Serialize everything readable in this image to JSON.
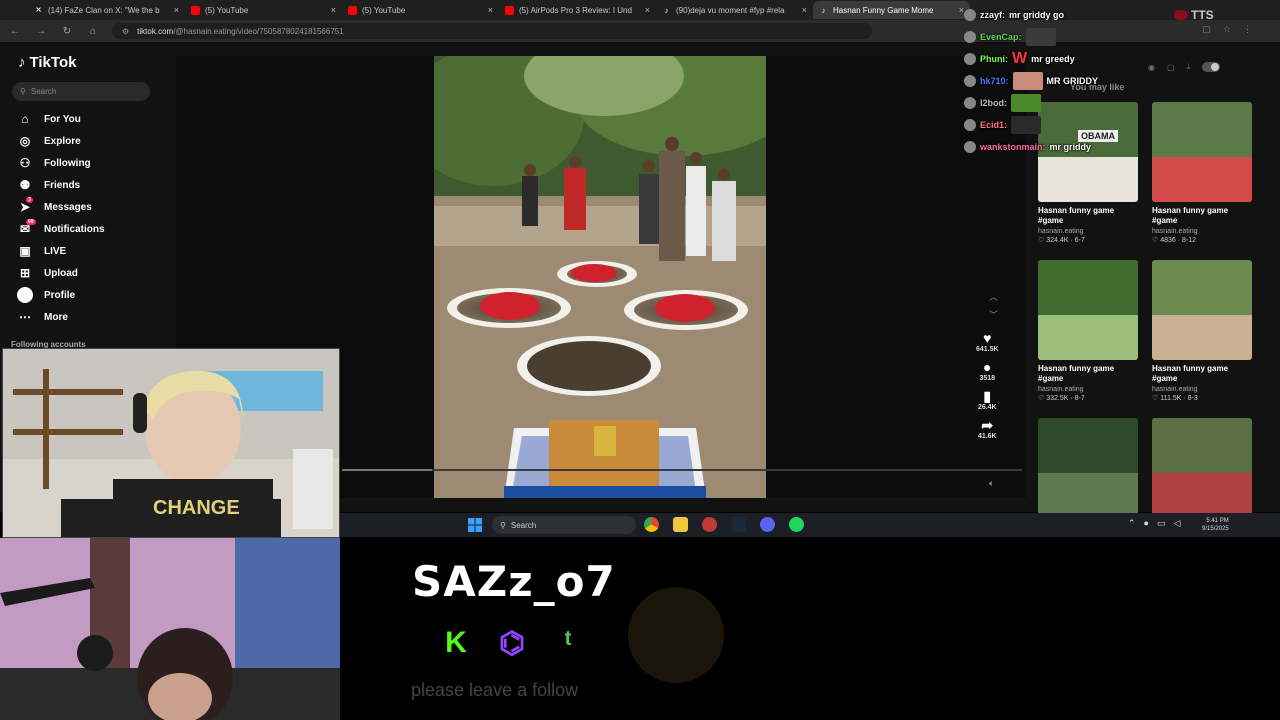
{
  "browser": {
    "tabs": [
      {
        "icon": "x",
        "label": "(14) FaZe Clan on X: \"We the b",
        "active": false
      },
      {
        "icon": "yt",
        "label": "(5) YouTube",
        "active": false
      },
      {
        "icon": "yt",
        "label": "(5) YouTube",
        "active": false
      },
      {
        "icon": "yt",
        "label": "(5) AirPods Pro 3 Review: I Und",
        "active": false
      },
      {
        "icon": "tt",
        "label": "(90)deja vu moment #fyp #rela",
        "active": false
      },
      {
        "icon": "tt",
        "label": "Hasnan Funny Game Mome",
        "active": true
      }
    ],
    "url_host": "tiktok.com",
    "url_path": "/@hasnain.eating/video/7505878024181566751"
  },
  "tiktok": {
    "logo": "TikTok",
    "search_placeholder": "Search",
    "nav": [
      {
        "icon": "home-icon",
        "glyph": "⌂",
        "label": "For You",
        "name": "nav-for-you"
      },
      {
        "icon": "compass-icon",
        "glyph": "◎",
        "label": "Explore",
        "name": "nav-explore"
      },
      {
        "icon": "following-icon",
        "glyph": "⚇",
        "label": "Following",
        "name": "nav-following"
      },
      {
        "icon": "friends-icon",
        "glyph": "⚉",
        "label": "Friends",
        "name": "nav-friends"
      },
      {
        "icon": "messages-icon",
        "glyph": "➤",
        "label": "Messages",
        "name": "nav-messages",
        "badge": "3"
      },
      {
        "icon": "bell-icon",
        "glyph": "✉",
        "label": "Notifications",
        "name": "nav-notifications",
        "badge": "99"
      },
      {
        "icon": "live-icon",
        "glyph": "▣",
        "label": "LIVE",
        "name": "nav-live"
      },
      {
        "icon": "upload-icon",
        "glyph": "⊞",
        "label": "Upload",
        "name": "nav-upload"
      },
      {
        "icon": "avatar",
        "glyph": "",
        "label": "Profile",
        "name": "nav-profile"
      },
      {
        "icon": "more-icon",
        "glyph": "⋯",
        "label": "More",
        "name": "nav-more"
      }
    ],
    "following_accounts": "Following accounts",
    "actions": {
      "likes": "641.5K",
      "comments": "3518",
      "saves": "26.4K",
      "shares": "41.6K"
    },
    "you_may_like": "You may like",
    "recommended": [
      {
        "title": "Hasnan funny game #game",
        "author": "hasnain.eating",
        "likes": "324.4K",
        "date": "6-7"
      },
      {
        "title": "Hasnan funny game #game",
        "author": "hasnain.eating",
        "likes": "4836",
        "date": "8-12"
      },
      {
        "title": "Hasnan funny game #game",
        "author": "hasnain.eating",
        "likes": "332.5K",
        "date": "8-7"
      },
      {
        "title": "Hasnan funny game #game",
        "author": "hasnain.eating",
        "likes": "111.5K",
        "date": "8-3"
      },
      {
        "title": "",
        "author": "",
        "likes": "",
        "date": ""
      },
      {
        "title": "",
        "author": "",
        "likes": "",
        "date": ""
      }
    ],
    "thumb_text_obama": "OBAMA"
  },
  "chat": [
    {
      "user": "zzayf:",
      "color": "#f3f3f3",
      "msg": "mr griddy go",
      "emote": ""
    },
    {
      "user": "EvenCap:",
      "color": "#5fd35f",
      "msg": "",
      "emote": "#3b3b3b"
    },
    {
      "user": "Phuni:",
      "color": "#7cff4a",
      "msg": "mr greedy",
      "emote_text": "W"
    },
    {
      "user": "hk710:",
      "color": "#4b74ff",
      "msg": "MR GRIDDY",
      "emote": "#c98b7a"
    },
    {
      "user": "l2bod:",
      "color": "#bdbdbd",
      "msg": "",
      "emote": "#4a8a2a"
    },
    {
      "user": "Ecid1:",
      "color": "#ff7a7a",
      "msg": "",
      "emote": "#2a2a2a"
    },
    {
      "user": "wankstonmain:",
      "color": "#ff6aa0",
      "msg": "mr griddy",
      "emote": ""
    }
  ],
  "tts_label": "TTS",
  "taskbar": {
    "search": "Search",
    "time": "5:41 PM",
    "date": "9/15/2025"
  },
  "streamer": {
    "name": "SAZz_o7",
    "follow_text": "please leave a follow",
    "socials": [
      {
        "name": "kick-icon",
        "glyph": "K"
      },
      {
        "name": "twitch-icon",
        "glyph": "⌬"
      },
      {
        "name": "tiktok-alt-icon",
        "glyph": "ᵗ"
      }
    ]
  },
  "colors": {
    "tiktok_red": "#fe2c55",
    "kick_green": "#53fc18",
    "twitch_purple": "#9146ff"
  }
}
